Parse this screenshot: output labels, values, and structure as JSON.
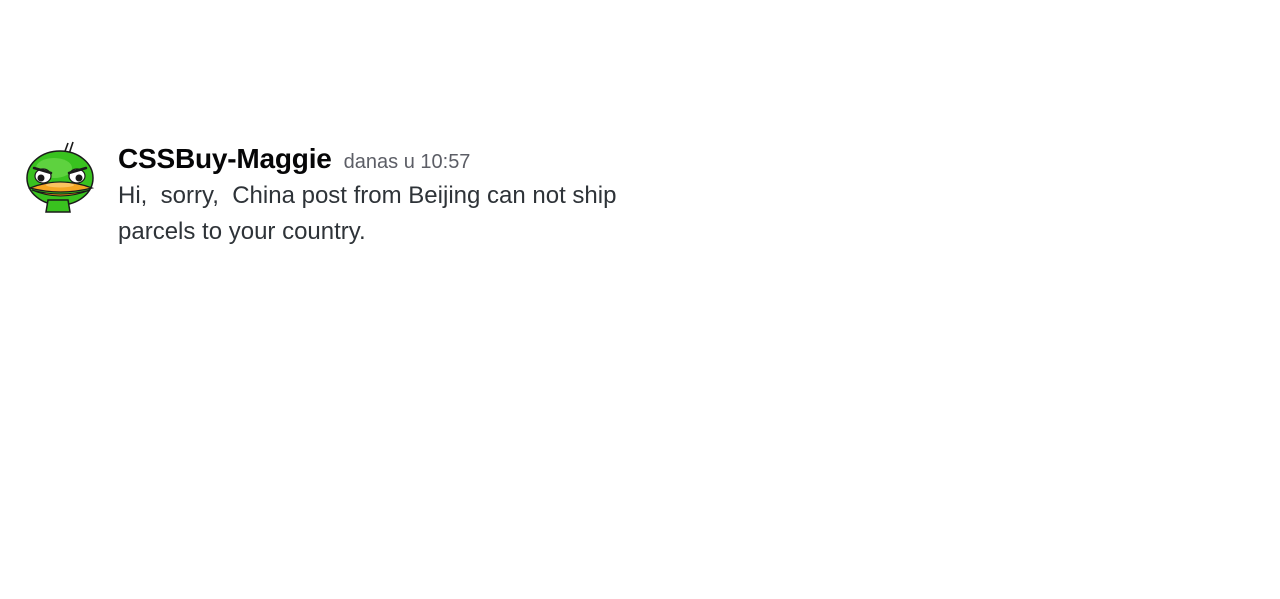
{
  "message": {
    "author": "CSSBuy-Maggie",
    "timestamp": "danas u 10:57",
    "text": "Hi,  sorry,  China post from Beijing can not ship parcels to your country."
  },
  "avatar": {
    "icon": "green-duck-icon",
    "colors": {
      "head": "#39c21f",
      "beak": "#f5a623",
      "outline": "#1a1a1a"
    }
  },
  "colors": {
    "author": "#060607",
    "timestamp": "#5c5e66",
    "text": "#2e3338",
    "background": "#ffffff"
  }
}
